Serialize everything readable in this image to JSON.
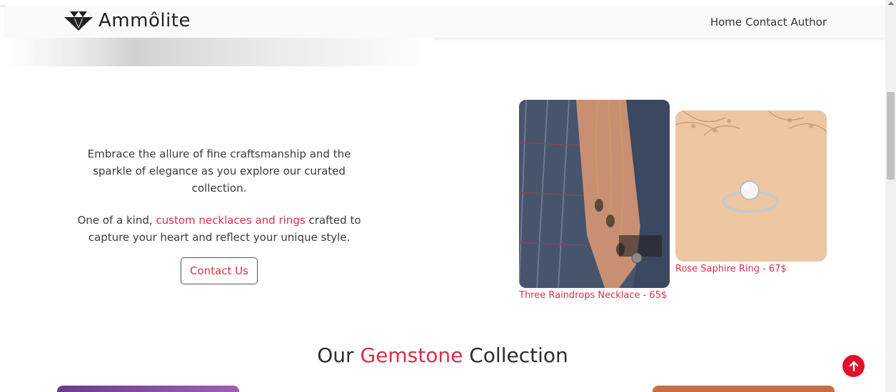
{
  "brand": {
    "name": "Ammôlite",
    "logo_icon": "diamond-icon"
  },
  "nav": {
    "items": [
      "Home",
      "Contact",
      "Author"
    ]
  },
  "hero": {
    "paragraph1": "Embrace the allure of fine craftsmanship and the sparkle of elegance as you explore our curated collection.",
    "paragraph2_before": "One of a kind, ",
    "paragraph2_accent": "custom necklaces and rings",
    "paragraph2_after": " crafted to capture your heart and reflect your unique style.",
    "button_label": "Contact Us"
  },
  "products": [
    {
      "caption": "Three Raindrops Necklace - 65$"
    },
    {
      "caption": "Rose Saphire Ring - 67$"
    }
  ],
  "collection": {
    "title_before": "Our ",
    "title_accent": "Gemstone",
    "title_after": " Collection"
  },
  "colors": {
    "accent": "#d6304a",
    "to_top": "#e3102b"
  },
  "icons": {
    "back_to_top": "arrow-up-icon"
  }
}
